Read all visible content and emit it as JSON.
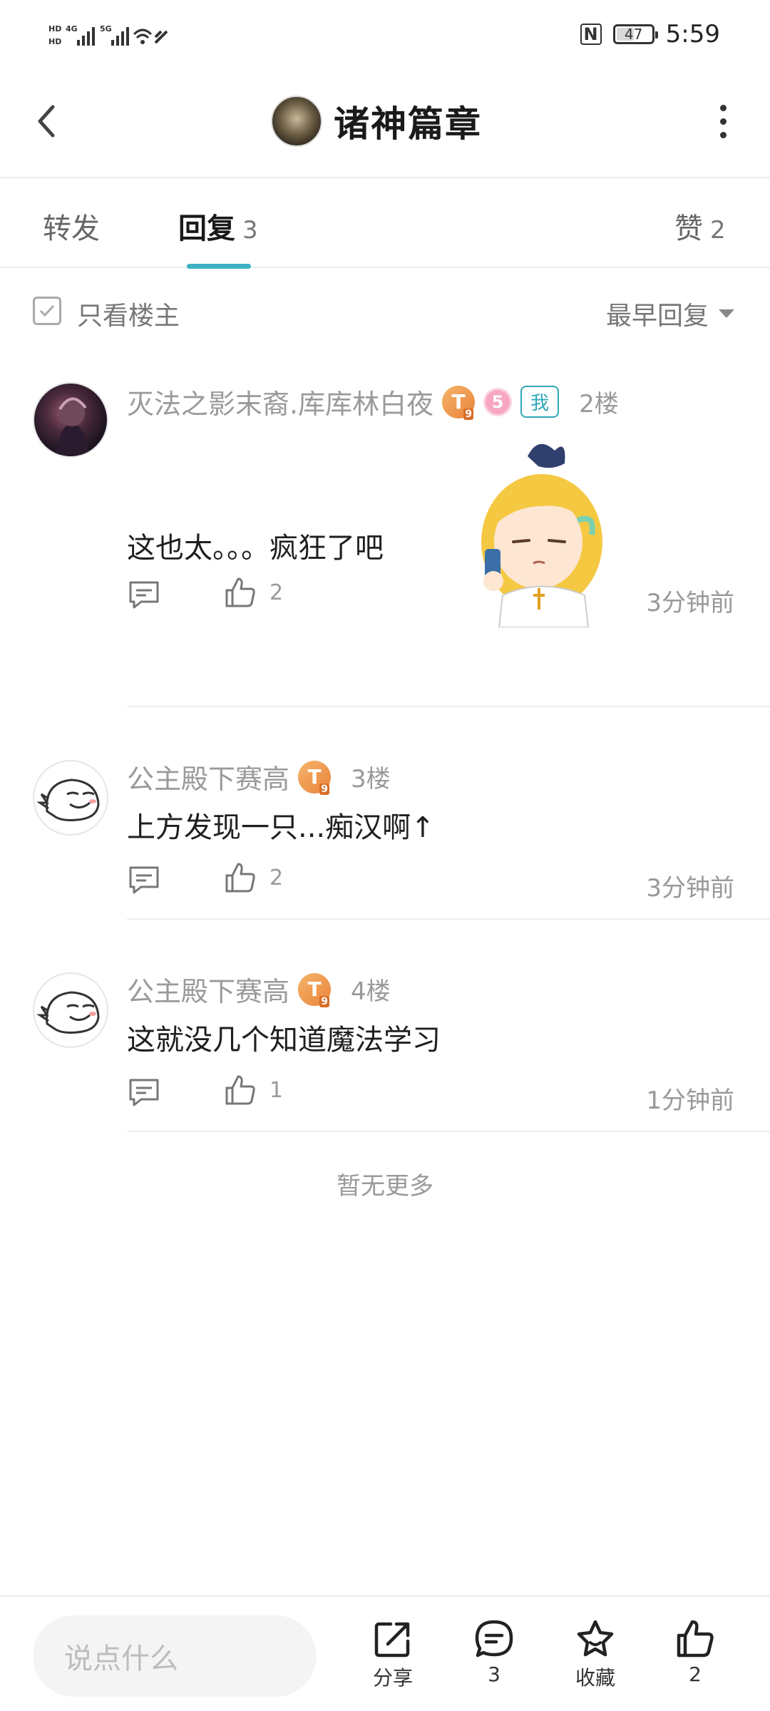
{
  "status_bar": {
    "network_left": [
      "HD",
      "4G",
      "5G",
      "6"
    ],
    "nfc": "N",
    "battery": "47",
    "time": "5:59"
  },
  "header": {
    "title": "诸神篇章",
    "back_icon": "chevron-left-icon",
    "more_icon": "more-vertical-icon"
  },
  "tabs": [
    {
      "label": "转发",
      "count": ""
    },
    {
      "label": "回复",
      "count": "3"
    },
    {
      "label": "赞",
      "count": "2"
    }
  ],
  "active_tab_index": 1,
  "filter": {
    "only_op_label": "只看楼主",
    "only_op_checked": false,
    "sort_label": "最早回复"
  },
  "replies": [
    {
      "username": "灭法之影末裔.库库林白夜",
      "badge_level": "T",
      "badge_sub": "9",
      "extra_badge": "5",
      "me_badge": "我",
      "floor": "2楼",
      "text": "这也太。。。疯狂了吧",
      "likes": "2",
      "time": "3分钟前",
      "has_sticker": true
    },
    {
      "username": "公主殿下赛高",
      "badge_level": "T",
      "badge_sub": "9",
      "floor": "3楼",
      "text": "上方发现一只...痴汉啊↑",
      "likes": "2",
      "time": "3分钟前"
    },
    {
      "username": "公主殿下赛高",
      "badge_level": "T",
      "badge_sub": "9",
      "floor": "4楼",
      "text": "这就没几个知道魔法学习",
      "likes": "1",
      "time": "1分钟前"
    }
  ],
  "no_more_text": "暂无更多",
  "bottom_bar": {
    "input_placeholder": "说点什么",
    "share_label": "分享",
    "comment_count": "3",
    "favorite_label": "收藏",
    "like_count": "2"
  },
  "colors": {
    "accent": "#3bb3c3",
    "badge_orange": "#e8843a",
    "badge_pink": "#f7a7c0",
    "text_secondary": "#9a9a9a"
  }
}
